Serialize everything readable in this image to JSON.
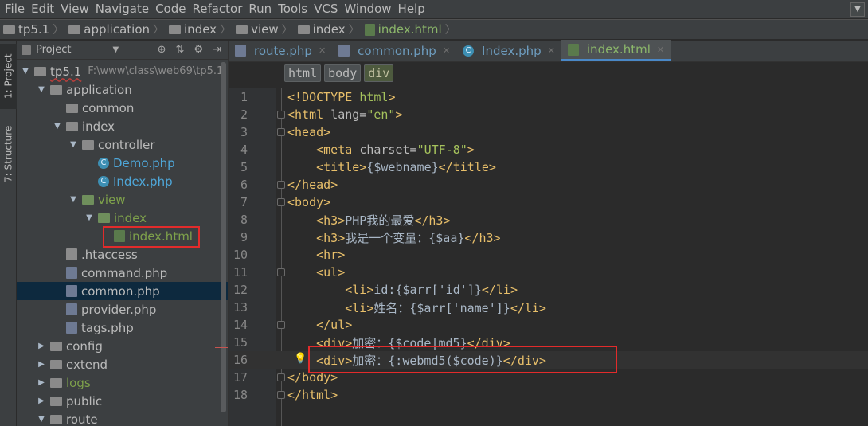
{
  "menu": [
    "File",
    "Edit",
    "View",
    "Navigate",
    "Code",
    "Refactor",
    "Run",
    "Tools",
    "VCS",
    "Window",
    "Help"
  ],
  "breadcrumb": [
    {
      "label": "tp5.1",
      "kind": "folder"
    },
    {
      "label": "application",
      "kind": "folder"
    },
    {
      "label": "index",
      "kind": "folder"
    },
    {
      "label": "view",
      "kind": "folder"
    },
    {
      "label": "index",
      "kind": "folder"
    },
    {
      "label": "index.html",
      "kind": "file"
    }
  ],
  "left_strip": {
    "project_tab": "1: Project",
    "structure_tab": "7: Structure"
  },
  "project_panel": {
    "title": "Project",
    "tree": [
      {
        "label": "tp5.1",
        "path": "F:\\www\\class\\web69\\tp5.1",
        "indent": 0,
        "arrow": "▼",
        "icon": "folder"
      },
      {
        "label": "application",
        "indent": 1,
        "arrow": "▼",
        "icon": "folder"
      },
      {
        "label": "common",
        "indent": 2,
        "arrow": "",
        "icon": "folder"
      },
      {
        "label": "index",
        "indent": 2,
        "arrow": "▼",
        "icon": "folder"
      },
      {
        "label": "controller",
        "indent": 3,
        "arrow": "▼",
        "icon": "folder"
      },
      {
        "label": "Demo.php",
        "indent": 4,
        "arrow": "",
        "icon": "class",
        "color": "blue"
      },
      {
        "label": "Index.php",
        "indent": 4,
        "arrow": "",
        "icon": "class",
        "color": "blue"
      },
      {
        "label": "view",
        "indent": 3,
        "arrow": "▼",
        "icon": "folder-green",
        "color": "green"
      },
      {
        "label": "index",
        "indent": 4,
        "arrow": "▼",
        "icon": "folder-green",
        "color": "green"
      },
      {
        "label": "index.html",
        "indent": 5,
        "arrow": "",
        "icon": "html",
        "color": "green"
      },
      {
        "label": ".htaccess",
        "indent": 2,
        "arrow": "",
        "icon": "ht"
      },
      {
        "label": "command.php",
        "indent": 2,
        "arrow": "",
        "icon": "php"
      },
      {
        "label": "common.php",
        "indent": 2,
        "arrow": "",
        "icon": "php",
        "selected": true
      },
      {
        "label": "provider.php",
        "indent": 2,
        "arrow": "",
        "icon": "php"
      },
      {
        "label": "tags.php",
        "indent": 2,
        "arrow": "",
        "icon": "php"
      },
      {
        "label": "config",
        "indent": 1,
        "arrow": "▶",
        "icon": "folder"
      },
      {
        "label": "extend",
        "indent": 1,
        "arrow": "▶",
        "icon": "folder"
      },
      {
        "label": "logs",
        "indent": 1,
        "arrow": "▶",
        "icon": "folder",
        "color": "green"
      },
      {
        "label": "public",
        "indent": 1,
        "arrow": "▶",
        "icon": "folder"
      },
      {
        "label": "route",
        "indent": 1,
        "arrow": "▼",
        "icon": "folder"
      }
    ]
  },
  "editor_tabs": [
    {
      "label": "route.php",
      "icon": "php",
      "active": false
    },
    {
      "label": "common.php",
      "icon": "php",
      "active": false
    },
    {
      "label": "Index.php",
      "icon": "class",
      "active": false
    },
    {
      "label": "index.html",
      "icon": "html",
      "active": true
    }
  ],
  "tag_breadcrumbs": [
    "html",
    "body",
    "div"
  ],
  "code_lines": [
    {
      "n": "1",
      "parts": [
        [
          "t-tag",
          "<!DOCTYPE "
        ],
        [
          "t-str",
          "html"
        ],
        [
          "t-tag",
          ">"
        ]
      ]
    },
    {
      "n": "2",
      "parts": [
        [
          "t-tag",
          "<html "
        ],
        [
          "t-attr",
          "lang="
        ],
        [
          "t-str",
          "\"en\""
        ],
        [
          "t-tag",
          ">"
        ]
      ]
    },
    {
      "n": "3",
      "parts": [
        [
          "t-tag",
          "<head>"
        ]
      ]
    },
    {
      "n": "4",
      "parts": [
        [
          "t-txt",
          "    "
        ],
        [
          "t-tag",
          "<meta "
        ],
        [
          "t-attr",
          "charset="
        ],
        [
          "t-str",
          "\"UTF-8\""
        ],
        [
          "t-tag",
          ">"
        ]
      ]
    },
    {
      "n": "5",
      "parts": [
        [
          "t-txt",
          "    "
        ],
        [
          "t-tag",
          "<title>"
        ],
        [
          "t-txt",
          "{$webname}"
        ],
        [
          "t-tag",
          "</title>"
        ]
      ]
    },
    {
      "n": "6",
      "parts": [
        [
          "t-tag",
          "</head>"
        ]
      ]
    },
    {
      "n": "7",
      "parts": [
        [
          "t-tag",
          "<body>"
        ]
      ]
    },
    {
      "n": "8",
      "parts": [
        [
          "t-txt",
          "    "
        ],
        [
          "t-tag",
          "<h3>"
        ],
        [
          "t-txt",
          "PHP我的最爱"
        ],
        [
          "t-tag",
          "</h3>"
        ]
      ]
    },
    {
      "n": "9",
      "parts": [
        [
          "t-txt",
          "    "
        ],
        [
          "t-tag",
          "<h3>"
        ],
        [
          "t-txt",
          "我是一个变量：{$aa}"
        ],
        [
          "t-tag",
          "</h3>"
        ]
      ]
    },
    {
      "n": "10",
      "parts": [
        [
          "t-txt",
          "    "
        ],
        [
          "t-tag",
          "<hr>"
        ]
      ]
    },
    {
      "n": "11",
      "parts": [
        [
          "t-txt",
          "    "
        ],
        [
          "t-tag",
          "<ul>"
        ]
      ]
    },
    {
      "n": "12",
      "parts": [
        [
          "t-txt",
          "        "
        ],
        [
          "t-tag",
          "<li>"
        ],
        [
          "t-txt",
          "id:{$arr['id']}"
        ],
        [
          "t-tag",
          "</li>"
        ]
      ]
    },
    {
      "n": "13",
      "parts": [
        [
          "t-txt",
          "        "
        ],
        [
          "t-tag",
          "<li>"
        ],
        [
          "t-txt",
          "姓名：{$arr['name']}"
        ],
        [
          "t-tag",
          "</li>"
        ]
      ]
    },
    {
      "n": "14",
      "parts": [
        [
          "t-txt",
          "    "
        ],
        [
          "t-tag",
          "</ul>"
        ]
      ]
    },
    {
      "n": "15",
      "parts": [
        [
          "t-txt",
          "    "
        ],
        [
          "t-tag",
          "<div>"
        ],
        [
          "t-txt",
          "加密：{$code|md5}"
        ],
        [
          "t-tag",
          "</div>"
        ]
      ]
    },
    {
      "n": "16",
      "parts": [
        [
          "t-txt",
          "    "
        ],
        [
          "t-tag",
          "<div>"
        ],
        [
          "t-txt",
          "加密：{:webmd5($code)}"
        ],
        [
          "t-tag",
          "</div>"
        ]
      ],
      "current": true
    },
    {
      "n": "17",
      "parts": [
        [
          "t-tag",
          "</body>"
        ]
      ]
    },
    {
      "n": "18",
      "parts": [
        [
          "t-tag",
          "</html>"
        ]
      ]
    }
  ],
  "colors": {
    "background": "#2b2b2b",
    "panel": "#3c3f41",
    "highlight_box": "#e22b2b",
    "selection": "#0d293e"
  }
}
